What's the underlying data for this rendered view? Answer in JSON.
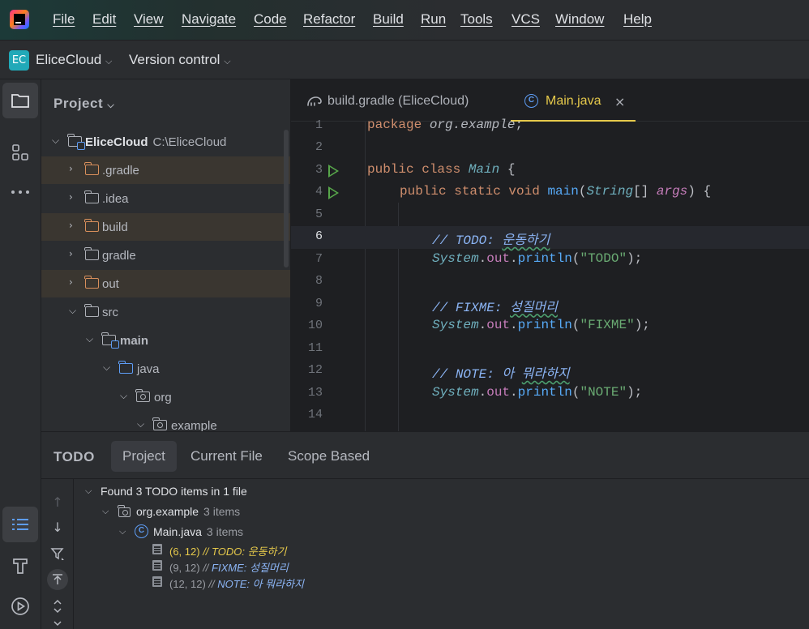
{
  "menu": {
    "items": [
      "File",
      "Edit",
      "View",
      "Navigate",
      "Code",
      "Refactor",
      "Build",
      "Run",
      "Tools",
      "VCS",
      "Window",
      "Help"
    ]
  },
  "toolbar": {
    "project_badge": "EC",
    "project_name": "EliceCloud",
    "vcs_label": "Version control"
  },
  "project_panel": {
    "title": "Project",
    "tree": [
      {
        "label": "EliceCloud",
        "path": "C:\\EliceCloud",
        "expanded": true
      },
      {
        "label": ".gradle",
        "expanded": false,
        "excluded": true
      },
      {
        "label": ".idea",
        "expanded": false
      },
      {
        "label": "build",
        "expanded": false,
        "excluded": true
      },
      {
        "label": "gradle",
        "expanded": false
      },
      {
        "label": "out",
        "expanded": false,
        "excluded": true
      },
      {
        "label": "src",
        "expanded": true
      },
      {
        "label": "main",
        "expanded": true
      },
      {
        "label": "java",
        "expanded": true
      },
      {
        "label": "org",
        "expanded": true
      },
      {
        "label": "example",
        "expanded": true
      }
    ]
  },
  "editor": {
    "tabs": [
      {
        "label": "build.gradle (EliceCloud)",
        "icon": "gradle-icon",
        "active": false
      },
      {
        "label": "Main.java",
        "icon": "java-class-icon",
        "active": true,
        "close": "×"
      }
    ],
    "current_line": 6,
    "lines": [
      {
        "n": "1"
      },
      {
        "n": "2"
      },
      {
        "n": "3"
      },
      {
        "n": "4"
      },
      {
        "n": "5"
      },
      {
        "n": "6"
      },
      {
        "n": "7"
      },
      {
        "n": "8"
      },
      {
        "n": "9"
      },
      {
        "n": "10"
      },
      {
        "n": "11"
      },
      {
        "n": "12"
      },
      {
        "n": "13"
      },
      {
        "n": "14"
      }
    ],
    "code": {
      "l1_kw": "package",
      "l1_pkg": "org.example",
      "l1_end": ";",
      "l3_kw": "public class",
      "l3_cls": "Main",
      "l3_end": " {",
      "l4_kw": "public static void",
      "l4_fn": "main",
      "l4_open": "(",
      "l4_type": "String",
      "l4_arr": "[] ",
      "l4_param": "args",
      "l4_end": ") {",
      "l6_comment": "// ",
      "l6_tag": "TODO: ",
      "l6_text": "운동하기",
      "l7_sys": "System",
      "l7_dot1": ".",
      "l7_out": "out",
      "l7_dot2": ".",
      "l7_fn": "println",
      "l7_open": "(",
      "l7_str": "\"TODO\"",
      "l7_end": ");",
      "l9_comment": "// ",
      "l9_tag": "FIXME: ",
      "l9_text": "성질머리",
      "l10_str": "\"FIXME\"",
      "l12_comment": "// ",
      "l12_tag": "NOTE: ",
      "l12_text1": "아 ",
      "l12_text2": "뭐라하지",
      "l13_str": "\"NOTE\""
    }
  },
  "todo_panel": {
    "title": "TODO",
    "tabs": [
      "Project",
      "Current File",
      "Scope Based"
    ],
    "active_tab": "Project",
    "summary": "Found 3 TODO items in 1 file",
    "package": {
      "label": "org.example",
      "count": "3 items"
    },
    "file": {
      "label": "Main.java",
      "count": "3 items"
    },
    "items": [
      {
        "loc": "(6, 12)",
        "slash": " // ",
        "text": "TODO: 운동하기",
        "selected": true
      },
      {
        "loc": "(9, 12)",
        "slash": " // ",
        "text": "FIXME: 성질머리",
        "selected": false
      },
      {
        "loc": "(12, 12)",
        "slash": " // ",
        "text": "NOTE: 아 뭐라하지",
        "selected": false
      }
    ]
  },
  "colors": {
    "background": "#1e1f22",
    "panel": "#2b2d30",
    "accent_tab": "#e6c94b",
    "keyword": "#cf8e6d",
    "string": "#6aab73",
    "todo_comment": "#8bb4f4",
    "excluded_row": "#3a3630",
    "run_gutter": "#57a64a"
  }
}
